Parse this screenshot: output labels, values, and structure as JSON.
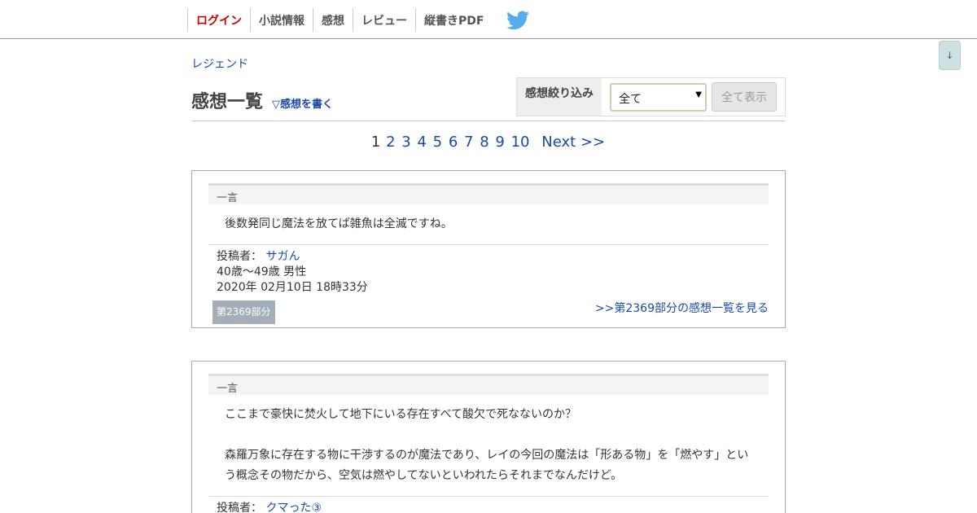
{
  "nav": {
    "login": "ログイン",
    "novel_info": "小説情報",
    "impressions": "感想",
    "review": "レビュー",
    "vertical_pdf": "縦書きPDF"
  },
  "scroll_button": "↓",
  "breadcrumb": "レジェンド",
  "title": "感想一覧",
  "write_link": "▽感想を書く",
  "filter": {
    "label": "感想絞り込み",
    "selected": "全て",
    "show_all": "全て表示"
  },
  "pager": {
    "current": "1",
    "pages": [
      "2",
      "3",
      "4",
      "5",
      "6",
      "7",
      "8",
      "9",
      "10"
    ],
    "next": "Next >>"
  },
  "comments": [
    {
      "section": "一言",
      "text1": "後数発同じ魔法を放てば雑魚は全滅ですね。",
      "author_label": "投稿者：",
      "author": "サガん",
      "age_gender": "40歳～49歳 男性",
      "date": "2020年 02月10日 18時33分",
      "part": "第2369部分",
      "part_link": ">>第2369部分の感想一覧を見る"
    },
    {
      "section": "一言",
      "text1": "ここまで豪快に焚火して地下にいる存在すべて酸欠で死なないのか？",
      "text2": "森羅万象に存在する物に干渉するのが魔法であり、レイの今回の魔法は「形ある物」を「燃やす」という概念その物だから、空気は燃やしてないといわれたらそれまでなんだけど。",
      "author_label": "投稿者：",
      "author": "クマった③"
    }
  ],
  "colors": {
    "link": "#1a4aa6",
    "login": "#cc0000",
    "twitter": "#55acee",
    "badge": "#a3aeb8"
  }
}
